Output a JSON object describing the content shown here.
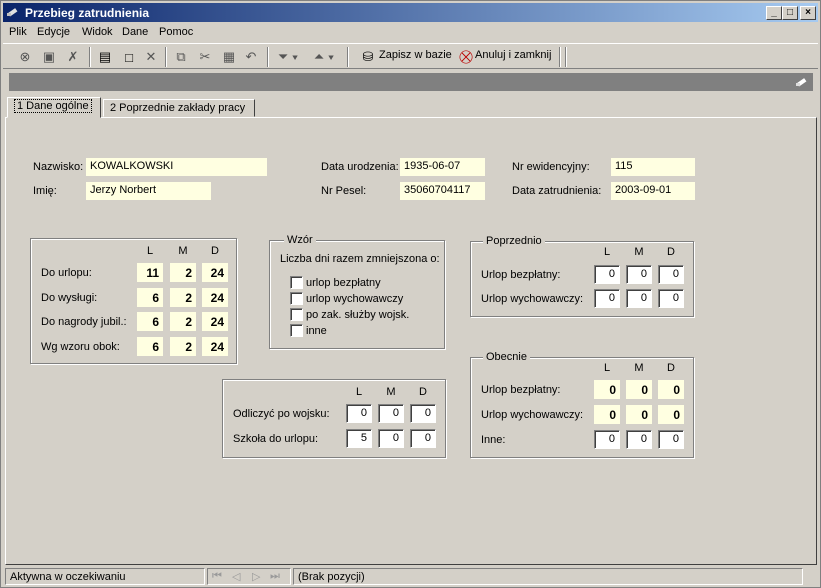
{
  "window": {
    "title": "Przebieg zatrudnienia"
  },
  "menu": [
    "Plik",
    "Edycje",
    "Widok",
    "Dane",
    "Pomoc"
  ],
  "toolbar": {
    "save_label": "Zapisz w bazie",
    "cancel_label": "Anuluj i zamknij"
  },
  "tabs": [
    "1 Dane ogólne",
    "2 Poprzednie zakłady pracy"
  ],
  "person": {
    "surname_label": "Nazwisko:",
    "surname": "KOWALKOWSKI",
    "name_label": "Imię:",
    "name": "Jerzy Norbert",
    "birth_label": "Data urodzenia:",
    "birth": "1935-06-07",
    "pesel_label": "Nr Pesel:",
    "pesel": "35060704117",
    "evid_label": "Nr ewidencyjny:",
    "evid": "115",
    "hire_label": "Data zatrudnienia:",
    "hire": "2003-09-01"
  },
  "cols": {
    "l": "L",
    "m": "M",
    "d": "D"
  },
  "summary": {
    "rows": [
      {
        "label": "Do urlopu:",
        "l": "11",
        "m": "2",
        "d": "24"
      },
      {
        "label": "Do wysługi:",
        "l": "6",
        "m": "2",
        "d": "24"
      },
      {
        "label": "Do nagrody jubil.:",
        "l": "6",
        "m": "2",
        "d": "24"
      },
      {
        "label": "Wg wzoru obok:",
        "l": "6",
        "m": "2",
        "d": "24"
      }
    ]
  },
  "wzor": {
    "title": "Wzór",
    "subtitle": "Liczba dni razem zmniejszona o:",
    "options": [
      "urlop bezpłatny",
      "urlop wychowawczy",
      "po zak. służby wojsk.",
      "inne"
    ]
  },
  "odliczyc": {
    "rows": [
      {
        "label": "Odliczyć po wojsku:",
        "l": "0",
        "m": "0",
        "d": "0"
      },
      {
        "label": "Szkoła do urlopu:",
        "l": "5",
        "m": "0",
        "d": "0"
      }
    ]
  },
  "poprzednio": {
    "title": "Poprzednio",
    "rows": [
      {
        "label": "Urlop bezpłatny:",
        "l": "0",
        "m": "0",
        "d": "0"
      },
      {
        "label": "Urlop wychowawczy:",
        "l": "0",
        "m": "0",
        "d": "0"
      }
    ]
  },
  "obecnie": {
    "title": "Obecnie",
    "rows": [
      {
        "label": "Urlop bezpłatny:",
        "l": "0",
        "m": "0",
        "d": "0"
      },
      {
        "label": "Urlop wychowawczy:",
        "l": "0",
        "m": "0",
        "d": "0"
      },
      {
        "label": "Inne:",
        "l": "0",
        "m": "0",
        "d": "0"
      }
    ]
  },
  "status": {
    "state": "Aktywna w oczekiwaniu",
    "position": "(Brak pozycji)"
  }
}
